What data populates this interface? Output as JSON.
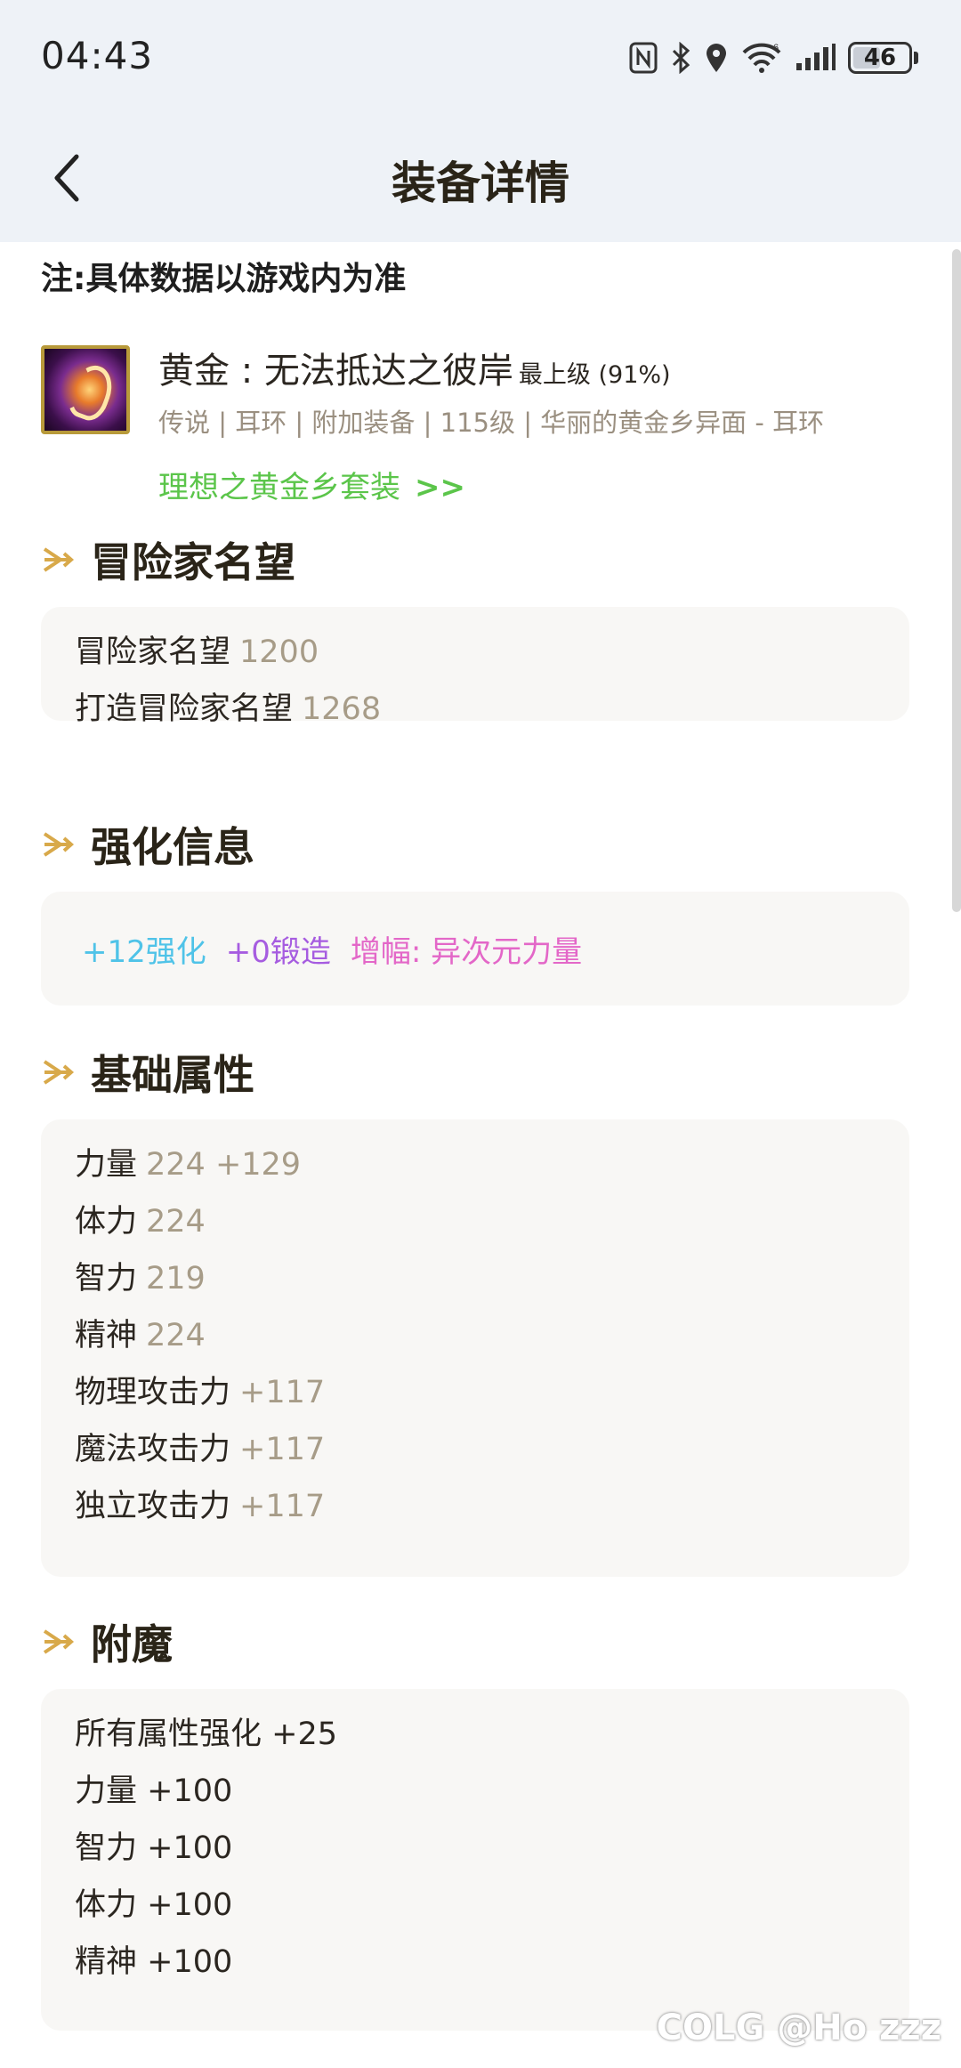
{
  "status_bar": {
    "time": "04:43",
    "battery": "46",
    "network_badge": "6"
  },
  "header": {
    "title": "装备详情",
    "back_icon": "chevron-left-icon"
  },
  "note": "注:具体数据以游戏内为准",
  "item": {
    "name": "黄金 : 无法抵达之彼岸",
    "grade": "最上级 (91%)",
    "meta": "传说 | 耳环 | 附加装备 | 115级 | 华丽的黄金乡异面 - 耳环",
    "set_link": "理想之黄金乡套装",
    "set_link_arrow": ">>"
  },
  "sections": {
    "fame": {
      "title": "冒险家名望",
      "rows": [
        {
          "label": "冒险家名望",
          "value": "1200"
        },
        {
          "label": "打造冒险家名望",
          "value": "1268"
        }
      ]
    },
    "enhance": {
      "title": "强化信息",
      "reinforce": "+12强化",
      "forge": "+0锻造",
      "amplify": "增幅: 异次元力量",
      "colors": {
        "reinforce": "#4fc3e8",
        "forge": "#a65ce0",
        "amplify": "#e367c8"
      }
    },
    "base": {
      "title": "基础属性",
      "rows": [
        {
          "label": "力量",
          "value": "224 +129"
        },
        {
          "label": "体力",
          "value": "224"
        },
        {
          "label": "智力",
          "value": "219"
        },
        {
          "label": "精神",
          "value": "224"
        },
        {
          "label": "物理攻击力",
          "value": "+117"
        },
        {
          "label": "魔法攻击力",
          "value": "+117"
        },
        {
          "label": "独立攻击力",
          "value": "+117"
        }
      ]
    },
    "enchant": {
      "title": "附魔",
      "rows": [
        "所有属性强化 +25",
        "力量 +100",
        "智力 +100",
        "体力 +100",
        "精神 +100"
      ]
    }
  },
  "watermark": "COLG @Ho zzz"
}
